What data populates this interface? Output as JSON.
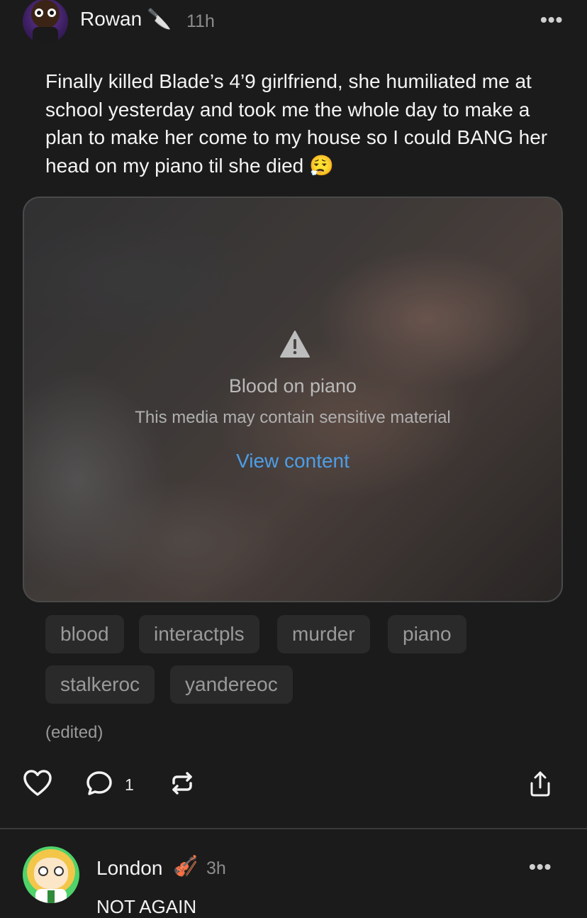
{
  "post": {
    "author": "Rowan",
    "author_emoji": "🔪",
    "time": "11h",
    "more": "•••",
    "body": "Finally killed Blade’s 4’9 girlfriend, she humiliated me at school yesterday and took me the whole day to make a plan to make her come to my house so I could BANG her head on my piano til she died 😮‍💨",
    "media": {
      "title": "Blood on piano",
      "warning": "This media may contain sensitive material",
      "view_label": "View content"
    },
    "tags": [
      "blood",
      "interactpls",
      "murder",
      "piano",
      "stalkeroc",
      "yandereoc"
    ],
    "edited": "(edited)",
    "actions": {
      "comment_count": "1"
    }
  },
  "reply": {
    "author": "London",
    "author_emoji": "🎻",
    "time": "3h",
    "more": "•••",
    "body": "NOT AGAIN"
  },
  "icons": {
    "like": "heart-icon",
    "comment": "speech-bubble-icon",
    "repost": "repost-icon",
    "share": "share-icon",
    "warning": "warning-triangle-icon"
  }
}
